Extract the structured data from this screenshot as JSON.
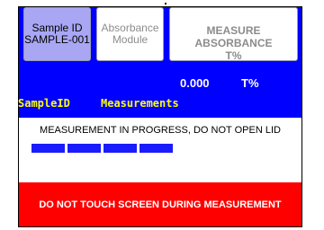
{
  "top_buttons": {
    "sample_id": {
      "label": "Sample ID",
      "value": "SAMPLE-001"
    },
    "absorbance_module": {
      "line1": "Absorbance",
      "line2": "Module"
    },
    "measure": {
      "line1": "MEASURE ABSORBANCE",
      "line2": "T%"
    }
  },
  "reading": {
    "value": "0.000",
    "unit": "T%"
  },
  "table_headers": {
    "sample_id": "SampleID",
    "measurements": "Measurements"
  },
  "status": {
    "message": "MEASUREMENT IN PROGRESS, DO NOT OPEN LID",
    "progress_segments_filled": 4,
    "progress_segments_total": 4
  },
  "warning": {
    "message": "DO NOT TOUCH SCREEN DURING MEASUREMENT"
  },
  "colors": {
    "background": "#0000ff",
    "selected_button": "#a9a7f4",
    "header_text": "#ffff00",
    "progress": "#1a1cff",
    "warning": "#ff0000"
  }
}
